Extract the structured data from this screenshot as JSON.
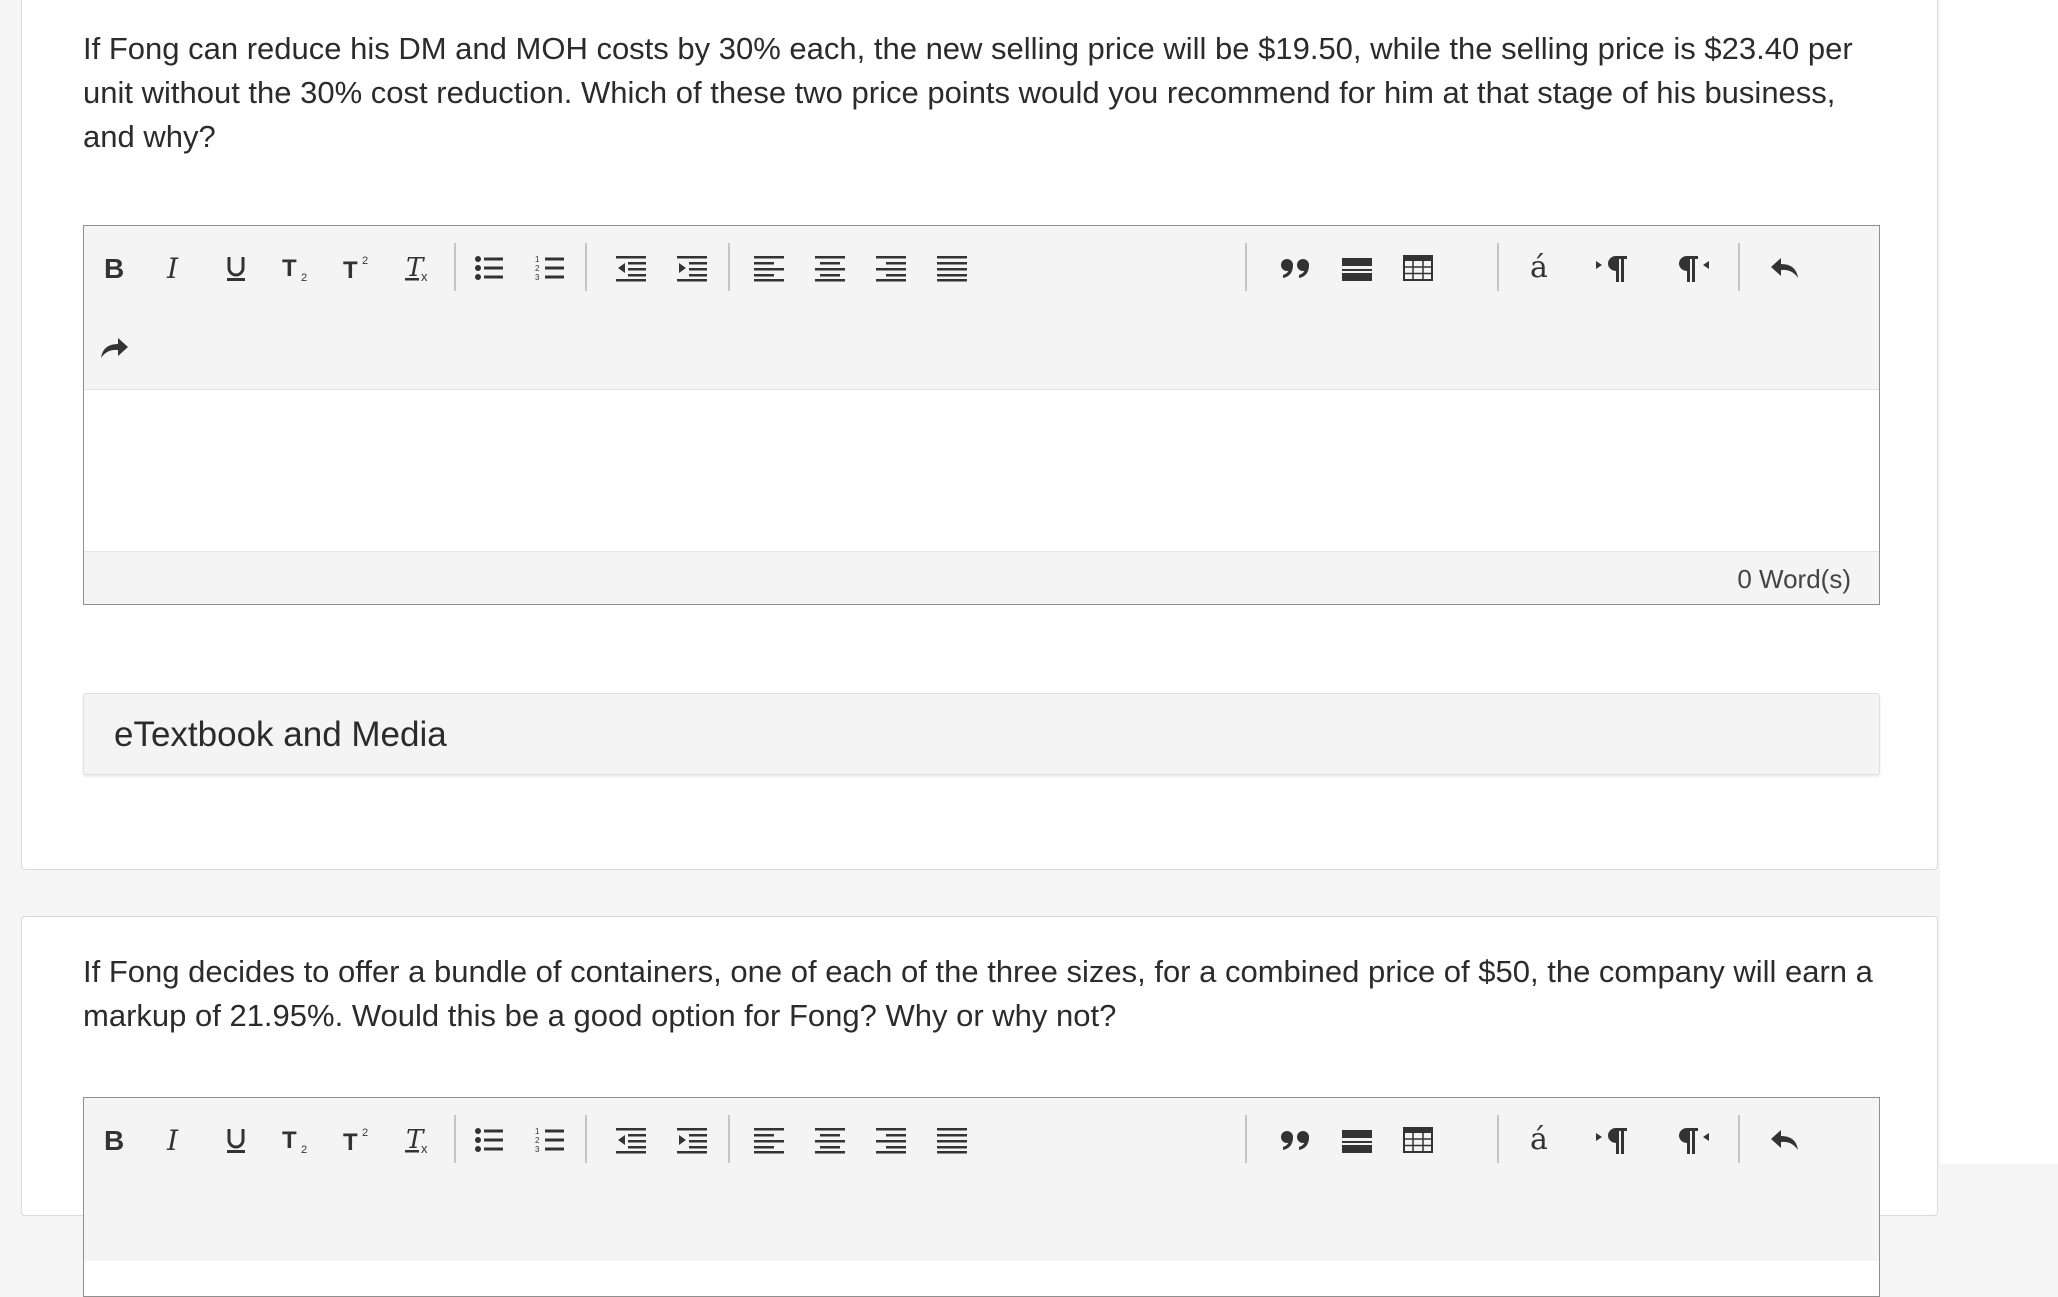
{
  "questions": [
    {
      "prompt": "If Fong can reduce his DM and MOH costs by 30% each, the new selling price will be $19.50, while the selling price is $23.40 per unit without the 30% cost reduction. Which of these two price points would you recommend for him at that stage of his business, and why?",
      "answer_value": "",
      "word_count": "0 Word(s)",
      "media_link": "eTextbook and Media"
    },
    {
      "prompt": "If Fong decides to offer a bundle of containers, one of each of the three sizes, for a combined price of $50, the company will earn a markup of 21.95%. Would this be a good option for Fong? Why or why not?"
    }
  ],
  "toolbar": {
    "buttons": [
      "bold-icon",
      "italic-icon",
      "underline-icon",
      "subscript-icon",
      "superscript-icon",
      "clear-format-icon",
      "bullet-list-icon",
      "numbered-list-icon",
      "outdent-icon",
      "indent-icon",
      "align-left-icon",
      "align-center-icon",
      "align-right-icon",
      "align-justify-icon",
      "blockquote-icon",
      "horizontal-rule-icon",
      "table-icon",
      "special-character-icon",
      "ltr-icon",
      "rtl-icon",
      "undo-icon",
      "redo-icon"
    ],
    "special_char": "á"
  }
}
